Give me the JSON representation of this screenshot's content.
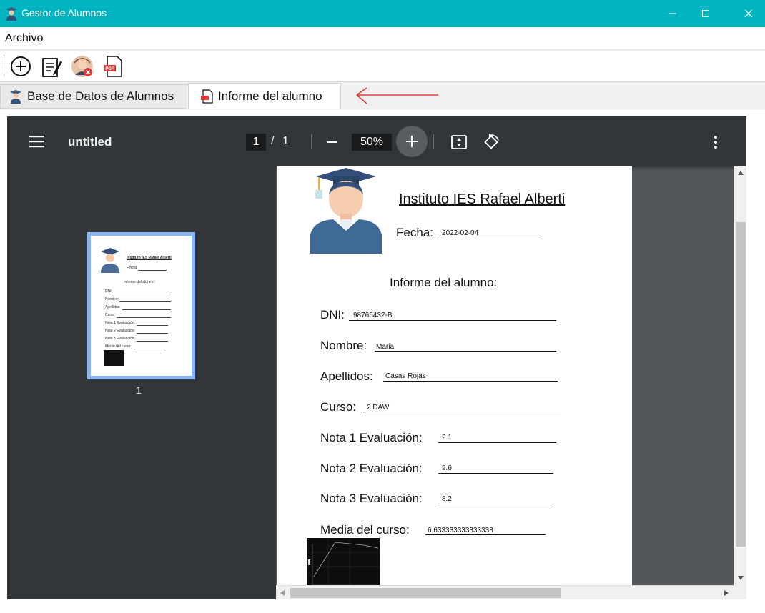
{
  "window": {
    "title": "Gestor de Alumnos"
  },
  "menu": {
    "file": "Archivo"
  },
  "toolbar": {
    "add_icon": "add-circle-icon",
    "edit_icon": "edit-document-icon",
    "delete_user_icon": "delete-user-icon",
    "pdf_icon": "pdf-icon"
  },
  "tabs": [
    {
      "label": "Base de Datos de Alumnos",
      "icon": "student-icon"
    },
    {
      "label": "Informe del alumno",
      "icon": "pdf-icon"
    }
  ],
  "pdf_viewer": {
    "title": "untitled",
    "current_page": "1",
    "separator": "/",
    "total_pages": "1",
    "zoom": "50%",
    "thumbnail_label": "1"
  },
  "report": {
    "institute": "Instituto IES Rafael Alberti",
    "date_label": "Fecha:",
    "date_value": "2022-02-04",
    "heading": "Informe del alumno:",
    "fields": [
      {
        "label": "DNI:",
        "value": "98765432-B"
      },
      {
        "label": "Nombre:",
        "value": "Maria"
      },
      {
        "label": "Apellidos:",
        "value": "Casas Rojas"
      },
      {
        "label": "Curso:",
        "value": "2 DAW"
      },
      {
        "label": "Nota 1 Evaluación:",
        "value": "2.1"
      },
      {
        "label": "Nota 2 Evaluación:",
        "value": "9.6"
      },
      {
        "label": "Nota 3 Evaluación:",
        "value": "8.2"
      },
      {
        "label": "Media del curso:",
        "value": "6.633333333333333"
      }
    ]
  },
  "colors": {
    "titlebar": "#00b4c0",
    "viewer_bg": "#525659",
    "viewer_toolbar": "#323639",
    "thumb_highlight": "#8ab4f8",
    "annotation_arrow": "#e53935"
  }
}
